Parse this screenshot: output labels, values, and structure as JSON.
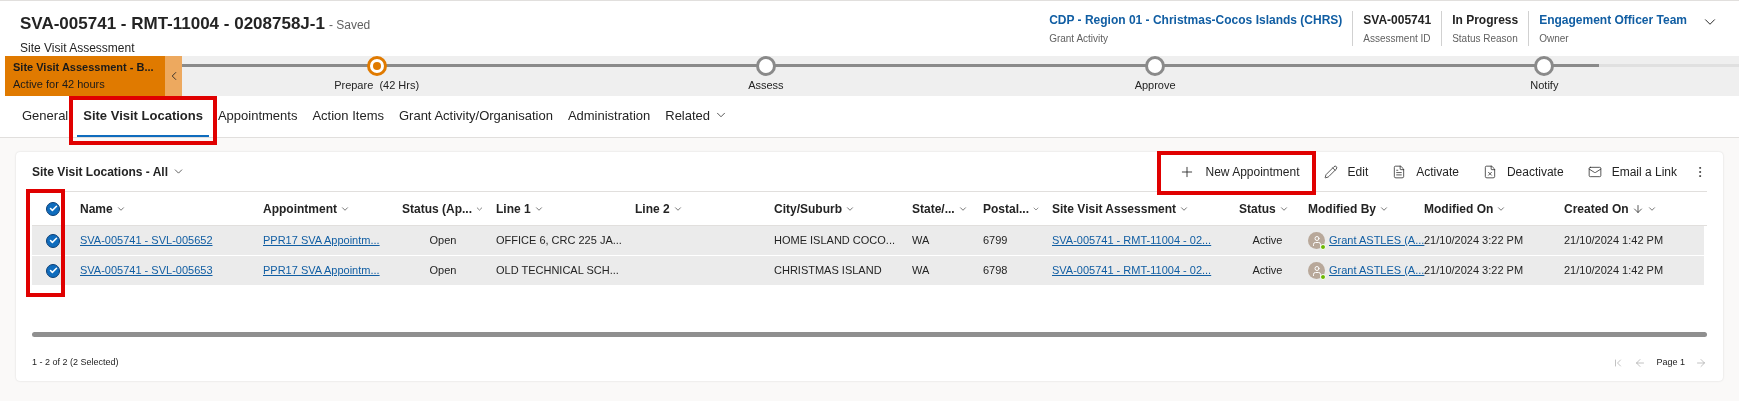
{
  "header": {
    "title": "SVA-005741 - RMT-11004 - 0208758J-1",
    "save_status": "- Saved",
    "entity": "Site Visit Assessment",
    "fields": [
      {
        "value": "CDP - Region 01 - Christmas-Cocos Islands (CHRS)",
        "label": "Grant Activity",
        "kind": "link"
      },
      {
        "value": "SVA-005741",
        "label": "Assessment ID",
        "kind": "text"
      },
      {
        "value": "In Progress",
        "label": "Status Reason",
        "kind": "text"
      },
      {
        "value": "Engagement Officer Team",
        "label": "Owner",
        "kind": "link"
      }
    ]
  },
  "process": {
    "active_stage": {
      "name": "Site Visit Assessment - B...",
      "duration": "Active for 42 hours"
    },
    "stages": [
      {
        "name": "Prepare",
        "duration": "(42 Hrs)",
        "selected": true
      },
      {
        "name": "Assess",
        "selected": false
      },
      {
        "name": "Approve",
        "selected": false
      },
      {
        "name": "Notify",
        "selected": false
      }
    ]
  },
  "tabs": [
    {
      "label": "General",
      "selected": false,
      "has_menu": false
    },
    {
      "label": "Site Visit Locations",
      "selected": true,
      "has_menu": false
    },
    {
      "label": "Appointments",
      "selected": false,
      "has_menu": false
    },
    {
      "label": "Action Items",
      "selected": false,
      "has_menu": false
    },
    {
      "label": "Grant Activity/Organisation",
      "selected": false,
      "has_menu": false
    },
    {
      "label": "Administration",
      "selected": false,
      "has_menu": false
    },
    {
      "label": "Related",
      "selected": false,
      "has_menu": true
    }
  ],
  "grid": {
    "view_name": "Site Visit Locations - All",
    "commands": [
      {
        "label": "New Appointment",
        "kind": "new"
      },
      {
        "label": "Edit",
        "kind": "edit"
      },
      {
        "label": "Activate",
        "kind": "activate"
      },
      {
        "label": "Deactivate",
        "kind": "deactivate"
      },
      {
        "label": "Email a Link",
        "kind": "email"
      }
    ],
    "all_selected": true,
    "columns": [
      {
        "label": "Name",
        "sorted": false
      },
      {
        "label": "Appointment",
        "sorted": false
      },
      {
        "label": "Status (Ap...",
        "sorted": false
      },
      {
        "label": "Line 1",
        "sorted": false
      },
      {
        "label": "Line 2",
        "sorted": false
      },
      {
        "label": "City/Suburb",
        "sorted": false
      },
      {
        "label": "State/...",
        "sorted": false
      },
      {
        "label": "Postal...",
        "sorted": false
      },
      {
        "label": "Site Visit Assessment",
        "sorted": false
      },
      {
        "label": "Status",
        "sorted": false
      },
      {
        "label": "Modified By",
        "sorted": false
      },
      {
        "label": "Modified On",
        "sorted": false
      },
      {
        "label": "Created On",
        "sorted": true
      }
    ],
    "rows": [
      {
        "selected": true,
        "cells": [
          {
            "kind": "link",
            "text": "SVA-005741 - SVL-005652"
          },
          {
            "kind": "link",
            "text": "PPR17 SVA Appointm..."
          },
          {
            "kind": "text",
            "text": "Open"
          },
          {
            "kind": "text",
            "text": "OFFICE 6, CRC 225 JA..."
          },
          {
            "kind": "empty"
          },
          {
            "kind": "text",
            "text": "HOME ISLAND COCO..."
          },
          {
            "kind": "text",
            "text": "WA"
          },
          {
            "kind": "text",
            "text": "6799"
          },
          {
            "kind": "link",
            "text": "SVA-005741 - RMT-11004 - 02..."
          },
          {
            "kind": "text",
            "text": "Active"
          },
          {
            "kind": "person",
            "text": "Grant ASTLES (A..."
          },
          {
            "kind": "text",
            "text": "21/10/2024 3:22 PM"
          },
          {
            "kind": "text",
            "text": "21/10/2024 1:42 PM"
          }
        ]
      },
      {
        "selected": true,
        "cells": [
          {
            "kind": "link",
            "text": "SVA-005741 - SVL-005653"
          },
          {
            "kind": "link",
            "text": "PPR17 SVA Appointm..."
          },
          {
            "kind": "text",
            "text": "Open"
          },
          {
            "kind": "text",
            "text": "OLD TECHNICAL SCH..."
          },
          {
            "kind": "empty"
          },
          {
            "kind": "text",
            "text": "CHRISTMAS ISLAND"
          },
          {
            "kind": "text",
            "text": "WA"
          },
          {
            "kind": "text",
            "text": "6798"
          },
          {
            "kind": "link",
            "text": "SVA-005741 - RMT-11004 - 02..."
          },
          {
            "kind": "text",
            "text": "Active"
          },
          {
            "kind": "person",
            "text": "Grant ASTLES (A..."
          },
          {
            "kind": "text",
            "text": "21/10/2024 3:22 PM"
          },
          {
            "kind": "text",
            "text": "21/10/2024 1:42 PM"
          }
        ]
      }
    ],
    "footer": {
      "count": "1 - 2 of 2 (2 Selected)",
      "page": "Page 1"
    }
  }
}
